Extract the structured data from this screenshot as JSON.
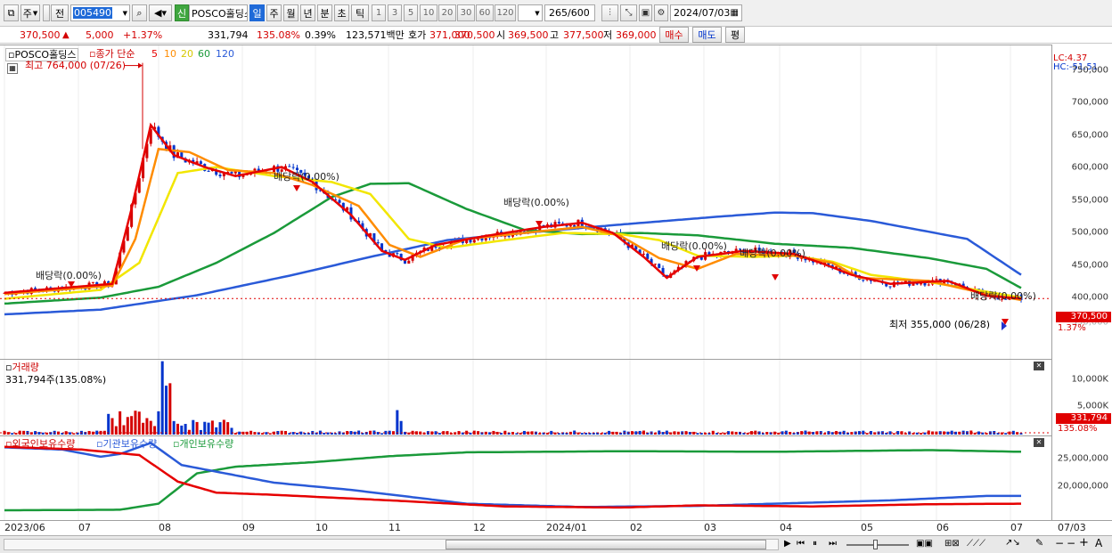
{
  "toolbar": {
    "market": "주",
    "type": "전",
    "code": "005490",
    "stock_name": "POSCO홀딩스",
    "pos_badge": "신",
    "periods": [
      "일",
      "주",
      "월",
      "년",
      "분",
      "초",
      "틱"
    ],
    "selected_period": "일",
    "minute_opts": [
      "1",
      "3",
      "5",
      "10",
      "20",
      "30",
      "60",
      "120"
    ],
    "count": "265",
    "count_total": "/600",
    "date": "2024/07/03"
  },
  "quote": {
    "price": "370,500",
    "arrow": "▲",
    "change": "5,000",
    "change_pct": "+1.37%",
    "volume": "331,794",
    "vol_ratio": "135.08%",
    "turnover": "0.39%",
    "amount": "123,571백만",
    "bid_label": "호가",
    "bid": "371,000",
    "ask": "370,500",
    "open_label": "시",
    "open": "369,500",
    "high_label": "고",
    "high": "377,500",
    "low_label": "저",
    "low": "369,000",
    "buy_btn": "매수",
    "sell_btn": "매도",
    "eval_btn": "평"
  },
  "colors": {
    "up": "#d40000",
    "down": "#0033cc",
    "ma5": "#e60000",
    "ma10": "#ff8c00",
    "ma20": "#f2e600",
    "ma60": "#1a9a3a",
    "ma120": "#2a5ad8",
    "foreign": "#2a5ad8",
    "inst": "#1a9a3a",
    "indiv": "#e60000"
  },
  "price_panel": {
    "legend_name": "POSCO홀딩스",
    "legend_ma": "종가 단순",
    "ma_periods": [
      "5",
      "10",
      "20",
      "60",
      "120"
    ],
    "max_label": "최고 764,000 (07/26)",
    "min_label": "최저 355,000 (06/28)",
    "lc": "LC:4.37",
    "hc": "HC:-51.51",
    "price_tag": "370,500",
    "pct_tag": "1.37%",
    "y_ticks": [
      "750,000",
      "700,000",
      "650,000",
      "600,000",
      "550,000",
      "500,000",
      "450,000",
      "400,000",
      "350,000"
    ],
    "dividends": [
      "배당락(0.00%)",
      "배당락(0.00%)",
      "배당락(0.00%)",
      "배당락(0.00%)",
      "배당락(0.00%)",
      "배당락(0.00%)"
    ]
  },
  "volume_panel": {
    "title": "거래량",
    "value": "331,794주(135.08%)",
    "y_ticks": [
      "10,000K",
      "5,000K"
    ],
    "tag": "331,794",
    "tag2": "135.08%"
  },
  "holding_panel": {
    "legend": [
      "외국인보유수량",
      "기관보유수량",
      "개인보유수량"
    ],
    "y_ticks": [
      "25,000,000",
      "20,000,000"
    ]
  },
  "x_axis": [
    "2023/06",
    "07",
    "08",
    "09",
    "10",
    "11",
    "12",
    "2024/01",
    "02",
    "03",
    "04",
    "05",
    "06",
    "07"
  ],
  "x_end": "07/03",
  "chart_data": {
    "type": "line",
    "title": "",
    "x_ticks": [
      "2023/06",
      "07",
      "08",
      "09",
      "10",
      "11",
      "12",
      "2024/01",
      "02",
      "03",
      "04",
      "05",
      "06",
      "07"
    ],
    "ma_series_approx": [
      {
        "name": "5",
        "values": [
          375000,
          395000,
          640000,
          580000,
          560000,
          430000,
          470000,
          490000,
          420000,
          440000,
          410000,
          395000,
          370000,
          370500
        ]
      },
      {
        "name": "20",
        "values": [
          380000,
          392000,
          580000,
          590000,
          560000,
          460000,
          470000,
          480000,
          440000,
          440000,
          420000,
          400000,
          380000,
          372000
        ]
      },
      {
        "name": "60",
        "values": [
          370000,
          380000,
          410000,
          500000,
          560000,
          520000,
          490000,
          480000,
          460000,
          450000,
          440000,
          410000,
          395000,
          385000
        ]
      },
      {
        "name": "120",
        "values": [
          350000,
          360000,
          380000,
          430000,
          470000,
          490000,
          505000,
          515000,
          495000,
          470000,
          450000,
          430000,
          415000,
          405000
        ]
      }
    ],
    "y_range": [
      340000,
      770000
    ]
  }
}
